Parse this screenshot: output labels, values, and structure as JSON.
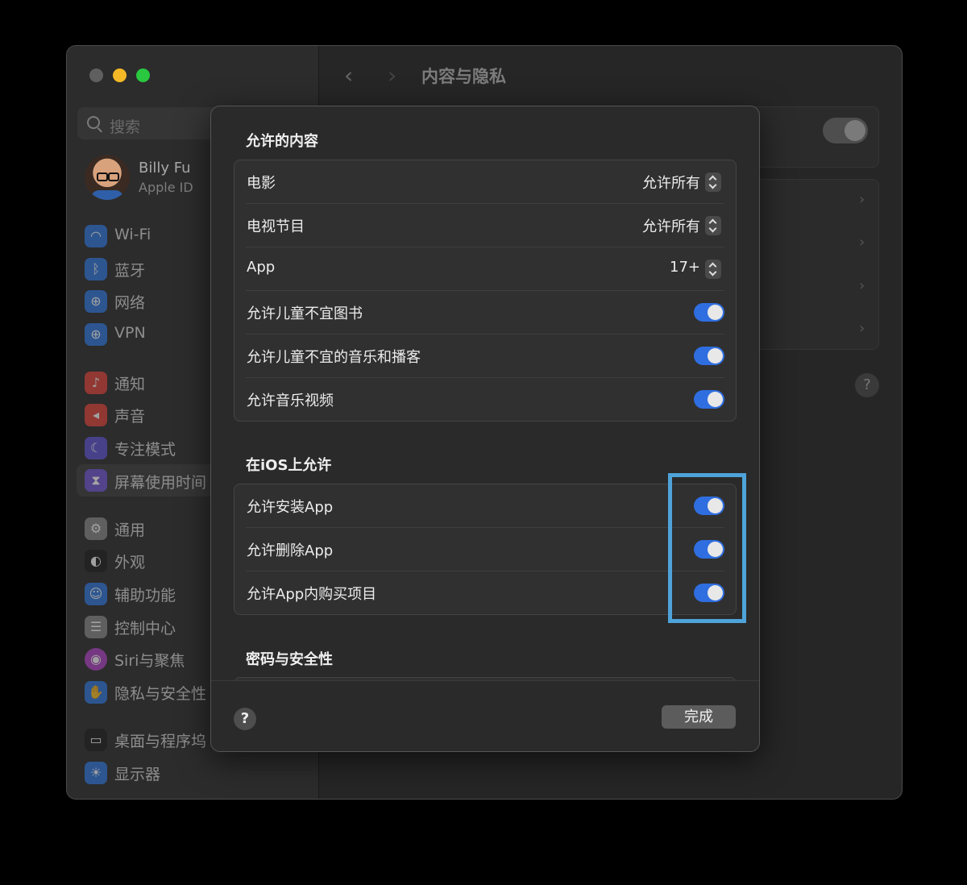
{
  "window": {
    "title": "内容与隐私",
    "nav": {
      "back_icon": "chevron-left-icon",
      "forward_icon": "chevron-right-icon"
    }
  },
  "sidebar": {
    "search_placeholder": "搜索",
    "profile": {
      "name": "Billy Fu",
      "subtitle": "Apple ID"
    },
    "items": [
      {
        "label": "Wi-Fi",
        "icon": "wifi-icon",
        "color": "#2f7ae5"
      },
      {
        "label": "蓝牙",
        "icon": "bluetooth-icon",
        "color": "#2f7ae5"
      },
      {
        "label": "网络",
        "icon": "globe-icon",
        "color": "#2f7ae5"
      },
      {
        "label": "VPN",
        "icon": "vpn-globe-icon",
        "color": "#2f7ae5"
      },
      {
        "label": "通知",
        "icon": "bell-icon",
        "color": "#e5423a"
      },
      {
        "label": "声音",
        "icon": "speaker-icon",
        "color": "#e5423a"
      },
      {
        "label": "专注模式",
        "icon": "moon-icon",
        "color": "#5d53d6"
      },
      {
        "label": "屏幕使用时间",
        "icon": "hourglass-icon",
        "color": "#6a4fd1"
      },
      {
        "label": "通用",
        "icon": "gear-icon",
        "color": "#8a8a8a"
      },
      {
        "label": "外观",
        "icon": "appearance-icon",
        "color": "#1c1c1c"
      },
      {
        "label": "辅助功能",
        "icon": "accessibility-icon",
        "color": "#2f7ae5"
      },
      {
        "label": "控制中心",
        "icon": "control-center-icon",
        "color": "#8a8a8a"
      },
      {
        "label": "Siri与聚焦",
        "icon": "siri-icon",
        "color": "#b443c9"
      },
      {
        "label": "隐私与安全性",
        "icon": "hand-icon",
        "color": "#2f7ae5"
      },
      {
        "label": "桌面与程序坞",
        "icon": "dock-icon",
        "color": "#1c1c1c"
      },
      {
        "label": "显示器",
        "icon": "sun-icon",
        "color": "#2f7ae5"
      }
    ]
  },
  "modal": {
    "section1": {
      "title": "允许的内容",
      "rows": [
        {
          "label": "电影",
          "value": "允许所有",
          "control": "stepper"
        },
        {
          "label": "电视节目",
          "value": "允许所有",
          "control": "stepper"
        },
        {
          "label": "App",
          "value": "17+",
          "control": "stepper"
        },
        {
          "label": "允许儿童不宜图书",
          "on": true
        },
        {
          "label": "允许儿童不宜的音乐和播客",
          "on": true
        },
        {
          "label": "允许音乐视频",
          "on": true
        }
      ]
    },
    "section2": {
      "title": "在iOS上允许",
      "rows": [
        {
          "label": "允许安装App",
          "on": true
        },
        {
          "label": "允许删除App",
          "on": true
        },
        {
          "label": "允许App内购买项目",
          "on": true
        }
      ]
    },
    "section3": {
      "title": "密码与安全性"
    },
    "help_label": "?",
    "done_label": "完成"
  },
  "background": {
    "help_label": "?"
  },
  "colors": {
    "accent": "#2f6ee0",
    "highlight": "#4ea3d9"
  }
}
